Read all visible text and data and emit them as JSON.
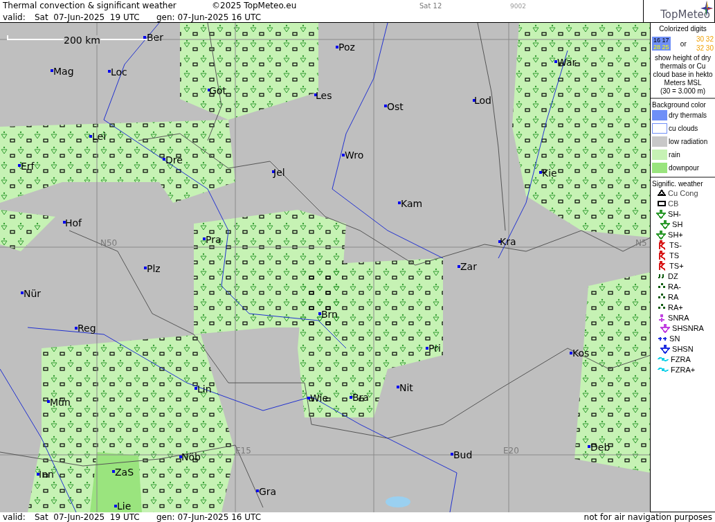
{
  "header": {
    "title": "Thermal convection & significant weather",
    "copyright": "©2025 TopMeteo.eu",
    "run": "Sat 12",
    "code": "9002",
    "valid_label": "valid:",
    "valid_value": "Sat  07-Jun-2025  19 UTC",
    "gen": "gen: 07-Jun-2025 16 UTC",
    "logo": "TopMeteo"
  },
  "map": {
    "scale": "200 km",
    "cities": [
      "Ber",
      "Poz",
      "Mag",
      "Loc",
      "Got",
      "Les",
      "War",
      "Lod",
      "Ost",
      "Lei",
      "Dre",
      "Wro",
      "Erf",
      "Jel",
      "Kie",
      "Kam",
      "Hof",
      "Pra",
      "Kra",
      "Plz",
      "Zar",
      "Nür",
      "Brn",
      "Reg",
      "Pri",
      "Kos",
      "Lin",
      "Nit",
      "Mün",
      "Wie",
      "Bra",
      "Deb",
      "Bud",
      "Nöb",
      "Inn",
      "ZaS",
      "Gra",
      "Lie"
    ],
    "grid_labels": [
      "N50",
      "E15",
      "E20",
      "N5"
    ]
  },
  "legend": {
    "digits_title": "Colorized digits",
    "sample_a": [
      "16 17",
      "28 25"
    ],
    "or": "or",
    "sample_b": [
      "30 32",
      "32 30"
    ],
    "digits_text": "show height of dry thermals or Cu cloud base in hekto Meters MSL",
    "digits_example": "(30 = 3.000 m)",
    "background_title": "Background color",
    "backgrounds": [
      {
        "label": "dry thermals",
        "color": "#6f8ff7"
      },
      {
        "label": "cu clouds",
        "color": "#ffffff"
      },
      {
        "label": "low radiation",
        "color": "#c8c8c8"
      },
      {
        "label": "rain",
        "color": "#c6f2b4"
      },
      {
        "label": "downpour",
        "color": "#9ae47e"
      }
    ],
    "weather_title": "Signific. weather",
    "weather": [
      {
        "label": "Cu Cong",
        "kind": "cu",
        "color": "#000000"
      },
      {
        "label": "CB",
        "kind": "cb",
        "color": "#000000"
      },
      {
        "label": "SH-",
        "kind": "shower",
        "color": "#2e9a2e"
      },
      {
        "label": "SH",
        "kind": "shower",
        "color": "#2e9a2e"
      },
      {
        "label": "SH+",
        "kind": "shower",
        "color": "#2e9a2e"
      },
      {
        "label": "TS-",
        "kind": "storm",
        "color": "#d81818"
      },
      {
        "label": "TS",
        "kind": "storm",
        "color": "#d81818"
      },
      {
        "label": "TS+",
        "kind": "storm",
        "color": "#d81818"
      },
      {
        "label": "DZ",
        "kind": "drizzle",
        "color": "#0c5a0c"
      },
      {
        "label": "RA-",
        "kind": "dots",
        "color": "#0c5a0c"
      },
      {
        "label": "RA",
        "kind": "dots",
        "color": "#0c5a0c"
      },
      {
        "label": "RA+",
        "kind": "dots",
        "color": "#0c5a0c"
      },
      {
        "label": "SNRA",
        "kind": "snowrain",
        "color": "#c040e0"
      },
      {
        "label": "SHSNRA",
        "kind": "shower",
        "color": "#c040e0"
      },
      {
        "label": "SN",
        "kind": "snow",
        "color": "#2030e0"
      },
      {
        "label": "SHSN",
        "kind": "shower",
        "color": "#2030e0"
      },
      {
        "label": "FZRA",
        "kind": "freezing",
        "color": "#10d0e8"
      },
      {
        "label": "FZRA+",
        "kind": "freezing",
        "color": "#10d0e8"
      }
    ]
  },
  "footer": {
    "valid_label": "valid:",
    "valid_value": "Sat  07-Jun-2025  19 UTC",
    "gen": "gen: 07-Jun-2025 16 UTC",
    "note": "not for air navigation purposes"
  }
}
